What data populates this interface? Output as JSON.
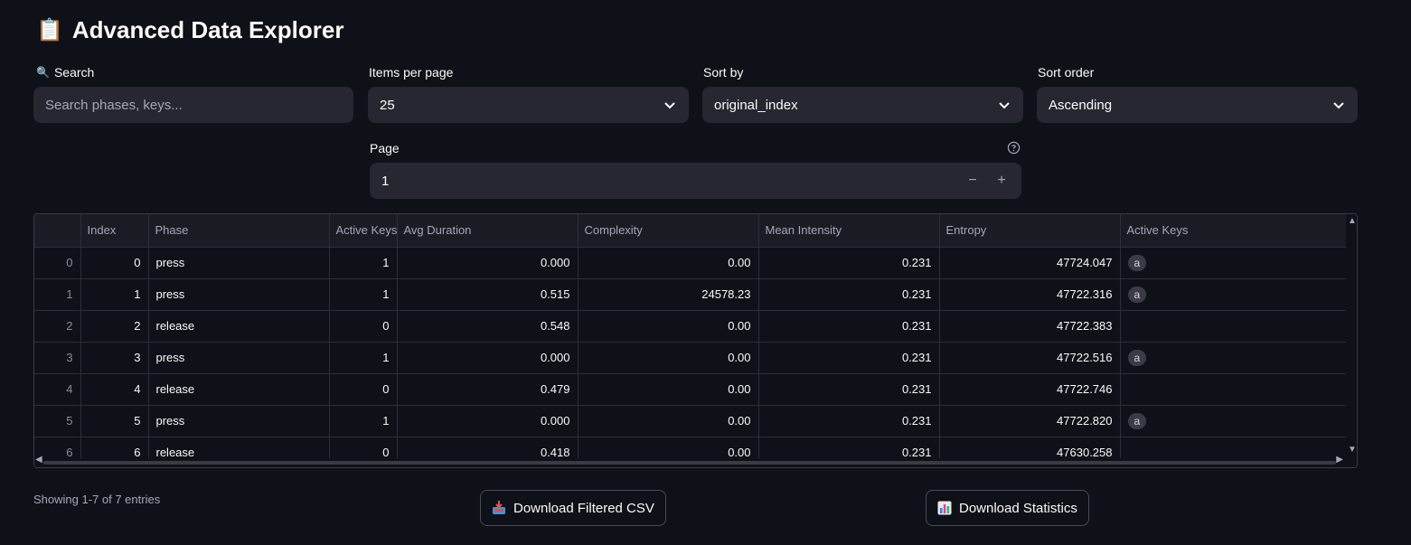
{
  "header": {
    "icon": "clipboard-icon",
    "title": "Advanced Data Explorer"
  },
  "filters": {
    "search": {
      "label": "Search",
      "icon": "magnifier-icon",
      "placeholder": "Search phases, keys..."
    },
    "items_per_page": {
      "label": "Items per page",
      "value": "25"
    },
    "sort_by": {
      "label": "Sort by",
      "value": "original_index"
    },
    "sort_order": {
      "label": "Sort order",
      "value": "Ascending"
    },
    "page": {
      "label": "Page",
      "value": "1",
      "minus": "−",
      "plus": "+"
    }
  },
  "table": {
    "columns": [
      "",
      "Index",
      "Phase",
      "Active Keys",
      "Avg Duration",
      "Complexity",
      "Mean Intensity",
      "Entropy",
      "Active Keys"
    ],
    "rows": [
      [
        "0",
        "0",
        "press",
        "1",
        "0.000",
        "0.00",
        "0.231",
        "47724.047",
        "a"
      ],
      [
        "1",
        "1",
        "press",
        "1",
        "0.515",
        "24578.23",
        "0.231",
        "47722.316",
        "a"
      ],
      [
        "2",
        "2",
        "release",
        "0",
        "0.548",
        "0.00",
        "0.231",
        "47722.383",
        ""
      ],
      [
        "3",
        "3",
        "press",
        "1",
        "0.000",
        "0.00",
        "0.231",
        "47722.516",
        "a"
      ],
      [
        "4",
        "4",
        "release",
        "0",
        "0.479",
        "0.00",
        "0.231",
        "47722.746",
        ""
      ],
      [
        "5",
        "5",
        "press",
        "1",
        "0.000",
        "0.00",
        "0.231",
        "47722.820",
        "a"
      ],
      [
        "6",
        "6",
        "release",
        "0",
        "0.418",
        "0.00",
        "0.231",
        "47630.258",
        ""
      ]
    ]
  },
  "footer": {
    "status": "Showing 1-7 of 7 entries",
    "download_csv": "Download Filtered CSV",
    "download_stats": "Download Statistics"
  },
  "colors": {
    "background": "#0e1117",
    "input_bg": "#262730",
    "text": "#fafafa"
  }
}
